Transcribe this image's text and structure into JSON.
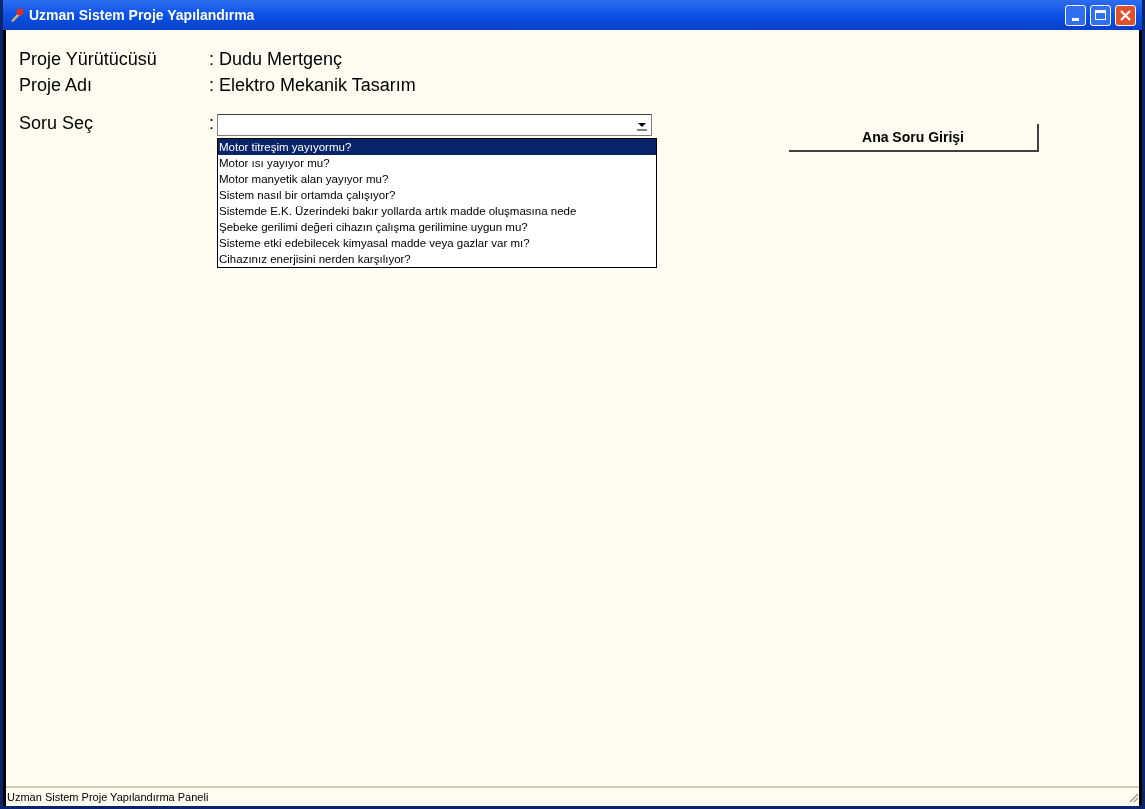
{
  "window": {
    "title": "Uzman Sistem Proje Yapılandırma"
  },
  "info_rows": [
    {
      "label": "Proje Yürütücüsü",
      "separator": ":",
      "value": "Dudu Mertgenç"
    },
    {
      "label": "Proje Adı",
      "separator": ":",
      "value": "Elektro Mekanik Tasarım"
    }
  ],
  "question_select": {
    "label": "Soru Seç",
    "separator": ":",
    "expanded": true,
    "options": [
      {
        "text": "Motor titreşim yayıyormu?",
        "selected": true
      },
      {
        "text": "Motor ısı yayıyor mu?",
        "selected": false
      },
      {
        "text": "Motor manyetik alan yayıyor mu?",
        "selected": false
      },
      {
        "text": "Sistem nasıl bir ortamda çalışıyor?",
        "selected": false
      },
      {
        "text": "Sistemde E.K. Üzerindeki bakır yollarda artık madde oluşmasına nede",
        "selected": false
      },
      {
        "text": "Şebeke gerilimi değeri cihazın çalışma gerilimine uygun mu?",
        "selected": false
      },
      {
        "text": "Sisteme etki edebilecek kimyasal madde veya gazlar var mı?",
        "selected": false
      },
      {
        "text": "Cihazınız enerjisini nerden karşılıyor?",
        "selected": false
      }
    ]
  },
  "button": {
    "label": "Ana Soru Girişi"
  },
  "status_bar": {
    "text": "Uzman Sistem Proje Yapılandırma Paneli"
  }
}
